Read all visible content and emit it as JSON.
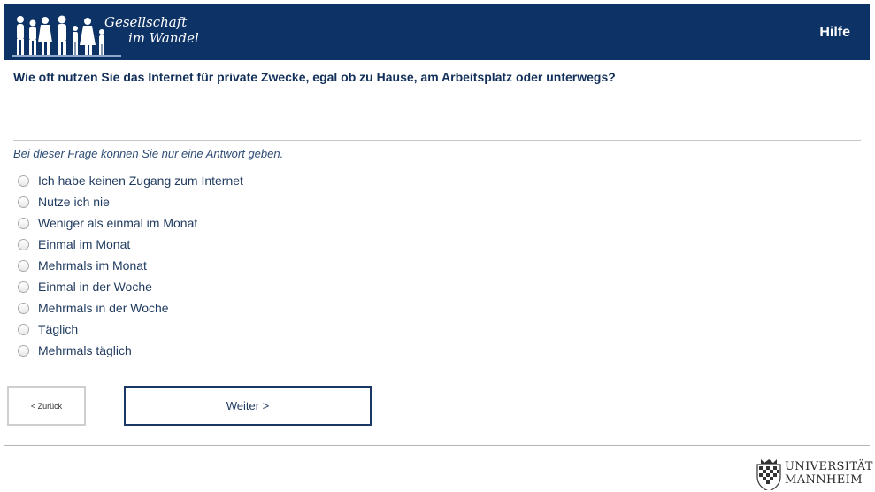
{
  "header": {
    "logo_line1": "Gesellschaft",
    "logo_line2": "im Wandel",
    "help_label": "Hilfe",
    "background_color": "#0d3266"
  },
  "question": {
    "text": "Wie oft nutzen Sie das Internet für private Zwecke, egal ob zu Hause, am Arbeitsplatz oder unterwegs?",
    "instruction": "Bei dieser Frage können Sie nur eine Antwort geben."
  },
  "options": [
    "Ich habe keinen Zugang zum Internet",
    "Nutze ich nie",
    "Weniger als einmal im Monat",
    "Einmal im Monat",
    "Mehrmals im Monat",
    "Einmal in der Woche",
    "Mehrmals in der Woche",
    "Täglich",
    "Mehrmals täglich"
  ],
  "navigation": {
    "back_label": "< Zurück",
    "next_label": "Weiter >"
  },
  "footer": {
    "university_line1": "UNIVERSITÄT",
    "university_line2": "MANNHEIM"
  },
  "icons": {
    "logo": "people-silhouettes-icon",
    "radio": "radio-button-icon",
    "university": "university-crest-icon"
  }
}
